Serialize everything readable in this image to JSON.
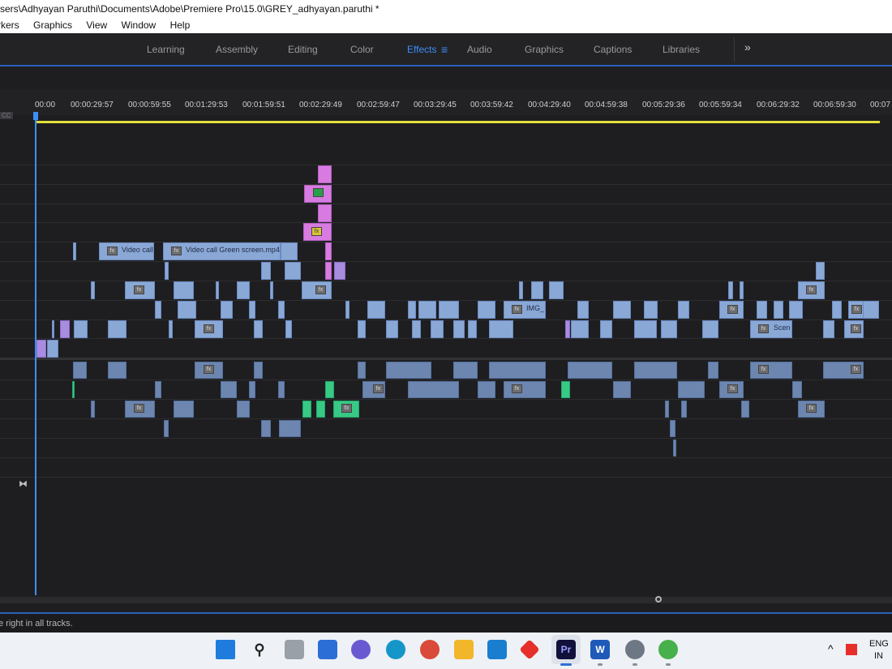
{
  "window": {
    "title": "sers\\Adhyayan Paruthi\\Documents\\Adobe\\Premiere Pro\\15.0\\GREY_adhyayan.paruthi *"
  },
  "menu": {
    "items": [
      "rkers",
      "Graphics",
      "View",
      "Window",
      "Help"
    ]
  },
  "workspaces": {
    "tabs": [
      "Learning",
      "Assembly",
      "Editing",
      "Color",
      "Effects",
      "Audio",
      "Graphics",
      "Captions",
      "Libraries"
    ],
    "active": "Effects",
    "more_icon": "double-chevron-right-icon",
    "menu_icon": "hamburger-icon"
  },
  "timeline": {
    "timecodes": [
      "00:00",
      "00:00:29:57",
      "00:00:59:55",
      "00:01:29:53",
      "00:01:59:51",
      "00:02:29:49",
      "00:02:59:47",
      "00:03:29:45",
      "00:03:59:42",
      "00:04:29:40",
      "00:04:59:38",
      "00:05:29:36",
      "00:05:59:34",
      "00:06:29:32",
      "00:06:59:30",
      "00:07"
    ],
    "cc_badge": "CC",
    "labels": {
      "video_call": "Video call",
      "green_screen": "Video call Green screen.mp4",
      "img": "IMG_",
      "scen": "Scen",
      "fx": "fx"
    }
  },
  "status": {
    "message": "e right in all tracks."
  },
  "taskbar": {
    "apps": [
      "windows-start",
      "search",
      "task-view",
      "widgets",
      "teams-chat",
      "edge",
      "chrome",
      "file-explorer",
      "mail",
      "app-red-diamond",
      "premiere-pro",
      "word",
      "settings",
      "android-app"
    ],
    "active": "premiere-pro",
    "premiere_label": "Pr",
    "word_label": "W",
    "language_line1": "ENG",
    "language_line2": "IN"
  },
  "colors": {
    "accent": "#3d8ef5",
    "video_clip": "#8aa8d6",
    "pink_clip": "#d77be0",
    "green_clip": "#37c985",
    "work_area": "#e3df3c"
  }
}
